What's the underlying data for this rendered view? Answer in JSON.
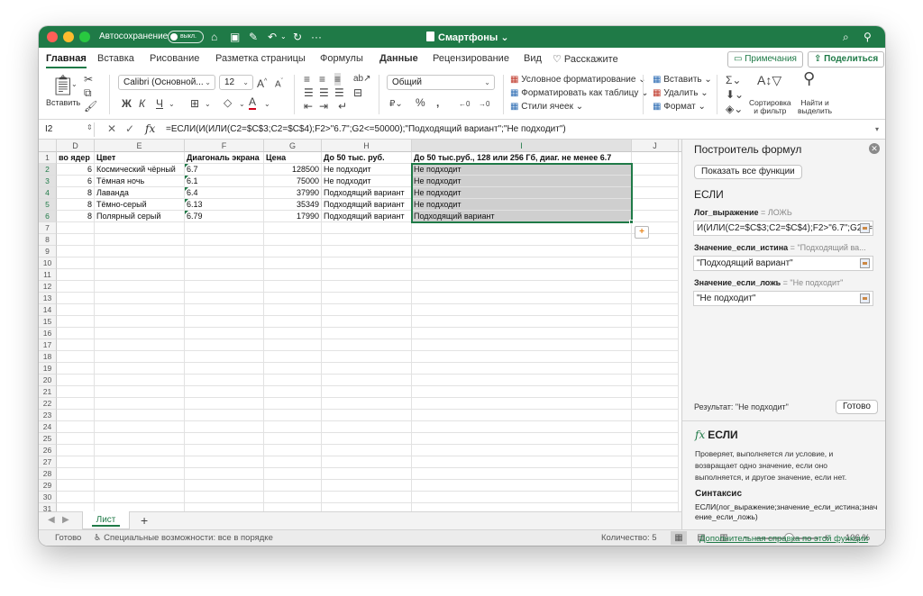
{
  "titlebar": {
    "autosave_label": "Автосохранение",
    "autosave_state": "выкл.",
    "doc_title": "Смартфоны",
    "more": "···"
  },
  "tabs": [
    "Главная",
    "Вставка",
    "Рисование",
    "Разметка страницы",
    "Формулы",
    "Данные",
    "Рецензирование",
    "Вид",
    "Расскажите"
  ],
  "tabs_active": "Главная",
  "header_buttons": {
    "notes": "Примечания",
    "share": "Поделиться"
  },
  "ribbon": {
    "paste": "Вставить",
    "font_name": "Calibri (Основной...",
    "font_size": "12",
    "bold": "Ж",
    "italic": "К",
    "underline": "Ч",
    "number_format": "Общий",
    "percent": "%",
    "thousands": "000",
    "cond_format": "Условное форматирование",
    "format_table": "Форматировать как таблицу",
    "cell_styles": "Стили ячеек",
    "insert": "Вставить",
    "delete": "Удалить",
    "format": "Формат",
    "sort_filter_1": "Сортировка",
    "sort_filter_2": "и фильтр",
    "find_select_1": "Найти и",
    "find_select_2": "выделить"
  },
  "formula_bar": {
    "cell_ref": "I2",
    "fx": "fx",
    "formula": "=ЕСЛИ(И(ИЛИ(C2=$C$3;C2=$C$4);F2>\"6.7\";G2<=50000);\"Подходящий вариант\";\"Не подходит\")"
  },
  "grid": {
    "columns": [
      "D",
      "E",
      "F",
      "G",
      "H",
      "I",
      "J"
    ],
    "row_numbers": [
      "1",
      "2",
      "3",
      "4",
      "5",
      "6",
      "7",
      "8",
      "9",
      "10",
      "11",
      "12",
      "13",
      "14",
      "15",
      "16",
      "17",
      "18",
      "19",
      "20",
      "21",
      "22",
      "23",
      "24",
      "25",
      "26",
      "27",
      "28",
      "29",
      "30",
      "31"
    ],
    "header_row": [
      "во ядер",
      "Цвет",
      "Диагональ экрана",
      "Цена",
      "До 50 тыс. руб.",
      "До 50 тыс.руб., 128 или 256 Гб, диаг. не менее 6.7"
    ],
    "rows": [
      [
        "6",
        "Космический чёрный",
        "6.7",
        "128500",
        "Не подходит",
        "Не подходит"
      ],
      [
        "6",
        "Тёмная ночь",
        "6.1",
        "75000",
        "Не подходит",
        "Не подходит"
      ],
      [
        "8",
        "Лаванда",
        "6.4",
        "37990",
        "Подходящий вариант",
        "Не подходит"
      ],
      [
        "8",
        "Тёмно-серый",
        "6.13",
        "35349",
        "Подходящий вариант",
        "Не подходит"
      ],
      [
        "8",
        "Полярный серый",
        "6.79",
        "17990",
        "Подходящий вариант",
        "Подходящий вариант"
      ]
    ]
  },
  "sheet_tabs": {
    "active": "Лист",
    "add": "+"
  },
  "statusbar": {
    "ready": "Готово",
    "accessibility": "Специальные возможности: все в порядке",
    "count": "Количество: 5",
    "zoom_minus": "−",
    "zoom_plus": "+",
    "zoom": "106 %"
  },
  "panel": {
    "title": "Построитель формул",
    "show_all": "Показать все функции",
    "function_name": "ЕСЛИ",
    "args": [
      {
        "label": "Лог_выражение",
        "result": "ЛОЖЬ",
        "value": "И(ИЛИ(C2=$C$3;C2=$C$4);F2>\"6.7\";G2<=50000)"
      },
      {
        "label": "Значение_если_истина",
        "result": "\"Подходящий ва...",
        "value": "\"Подходящий вариант\""
      },
      {
        "label": "Значение_если_ложь",
        "result": "\"Не подходит\"",
        "value": "\"Не подходит\""
      }
    ],
    "equals": "=",
    "result_text": "Результат: \"Не подходит\"",
    "done": "Готово",
    "help_fx": "fx",
    "help_title": "ЕСЛИ",
    "help_desc": "Проверяет, выполняется ли условие, и возвращает одно значение, если оно выполняется, и другое значение, если нет.",
    "syntax_title": "Синтаксис",
    "syntax": "ЕСЛИ(лог_выражение;значение_если_истина;значение_если_ложь)",
    "more_help": "Дополнительная справка по этой функции"
  },
  "colors": {
    "accent": "#1f7a47",
    "selection_fill": "#cfcfcf",
    "link": "#1f7a47"
  }
}
